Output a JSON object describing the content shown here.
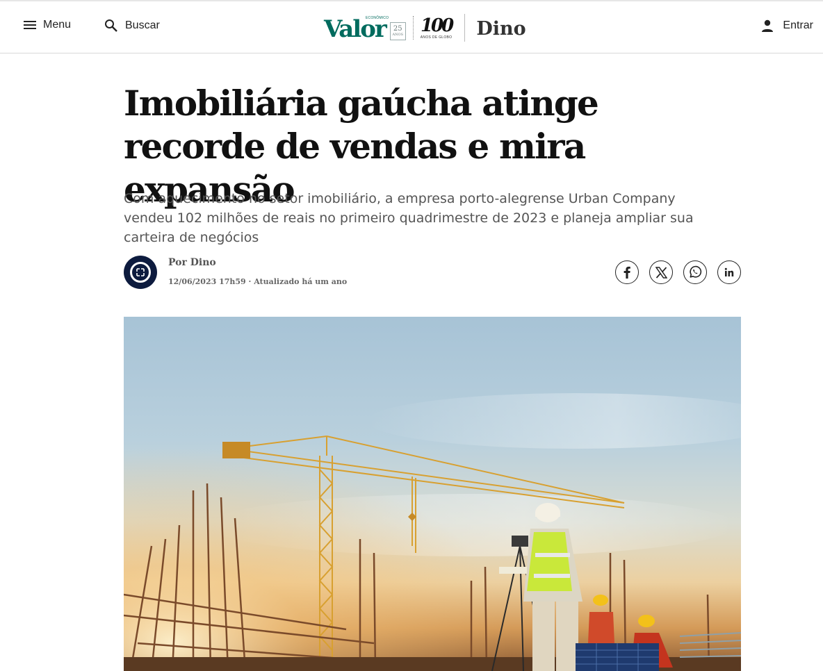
{
  "header": {
    "menu_label": "Menu",
    "search_label": "Buscar",
    "login_label": "Entrar",
    "logo": {
      "valor_text": "Valor",
      "valor_small": "ECONÔMICO",
      "anos_number": "25",
      "anos_label": "ANOS",
      "globo_number": "100",
      "globo_label": "ANOS DE GLOBO",
      "section_name": "Dino"
    }
  },
  "article": {
    "title": "Imobiliária gaúcha atinge recorde de vendas e mira expansão",
    "subtitle": "Com aquecimento no setor imobiliário, a empresa porto-alegrense Urban Company vendeu 102 milhões de reais no primeiro quadrimestre de 2023 e planeja ampliar sua carteira de negócios",
    "author": "Por Dino",
    "dateline": "12/06/2023 17h59 · Atualizado há um ano"
  },
  "share": {
    "buttons": [
      "facebook-icon",
      "x-icon",
      "whatsapp-icon",
      "linkedin-icon"
    ]
  },
  "colors": {
    "valor_green": "#006b5e",
    "avatar_navy": "#0d1b3e",
    "headline": "#111111",
    "subtitle": "#555555"
  }
}
